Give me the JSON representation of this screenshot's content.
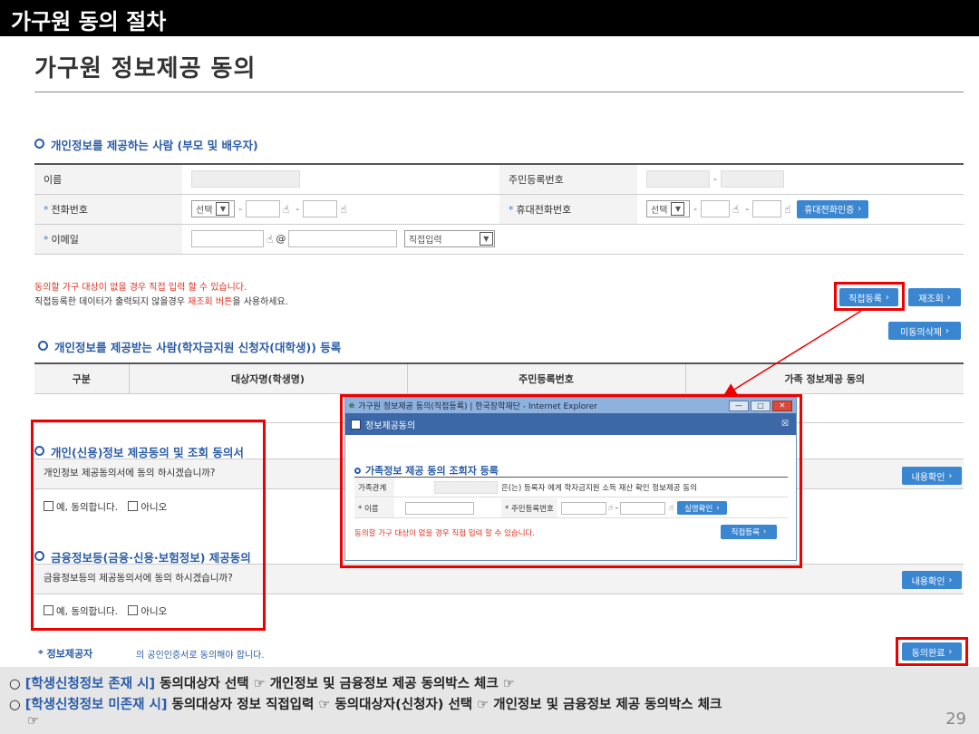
{
  "banner": "가구원 동의 절차",
  "page_title": "가구원 정보제공 동의",
  "provider_section": {
    "heading": "개인정보를 제공하는 사람 (부모 및 배우자)",
    "name_label": "이름",
    "rrn_label": "주민등록번호",
    "phone_label": "전화번호",
    "phone_select": "선택",
    "mobile_label": "휴대전화번호",
    "mobile_select": "선택",
    "mobile_verify_btn": "휴대전화인증",
    "email_label": "이메일",
    "email_at": "@",
    "email_domain_select": "직접입력"
  },
  "notes": {
    "line1": "동의할 가구 대상이 없을 경우 직접 입력 할 수 있습니다.",
    "line2_prefix": "직접등록한 데이터가 출력되지 않을경우 ",
    "line2_highlight": "재조회 버튼",
    "line2_suffix": "을 사용하세요."
  },
  "buttons": {
    "direct_register": "직접등록",
    "re_query": "재조회",
    "delete_unagreed": "미동의삭제",
    "view_content_1": "내용확인",
    "view_content_2": "내용확인",
    "agree_complete": "동의완료"
  },
  "recipient_section": {
    "heading": "개인정보를 제공받는 사람(학자금지원 신청자(대학생)) 등록",
    "columns": [
      "구분",
      "대상자명(학생명)",
      "주민등록번호",
      "가족 정보제공 동의"
    ]
  },
  "personal_credit": {
    "heading": "개인(신용)정보 제공동의 및 조회 동의서",
    "question": "개인정보 제공동의서에 동의 하시겠습니까?",
    "yes": "예, 동의합니다.",
    "no": "아니오"
  },
  "financial": {
    "heading": "금융정보등(금융·신용·보험정보) 제공동의",
    "question": "금융정보등의 제공동의서에 동의 하시겠습니까?",
    "yes": "예, 동의합니다.",
    "no": "아니오"
  },
  "info_provider": {
    "label": "* 정보제공자",
    "text": "의 공인인증서로 동의해야 합니다."
  },
  "popup": {
    "window_title": "가구원 정보제공 동의(직접등록) | 한국장학재단 - Internet Explorer",
    "win_min": "—",
    "win_max": "□",
    "win_close": "✕",
    "inner_title": "정보제공동의",
    "inner_close": "☒",
    "section_heading": "가족정보 제공 동의 조회자 등록",
    "relation_label": "가족관계",
    "relation_text": "은(는) 등록자 에게 학자금지원 소득 재산 확인 정보제공 동의",
    "name_label": "* 이름",
    "rrn_label": "* 주민등록번호",
    "verify_btn": "실명확인",
    "note": "동의할 가구 대상이 없을 경우 직접 입력 할 수 있습니다.",
    "register_btn": "직접등록"
  },
  "footer": {
    "line1_hl": "[학생신청정보 존재 시]",
    "line1_text": " 동의대상자 선택 ☞ 개인정보 및 금융정보 제공 동의박스 체크 ☞",
    "line2_hl": "[학생신청정보 미존재 시]",
    "line2_text": " 동의대상자 정보 직접입력 ☞ 동의대상자(신청자) 선택 ☞ 개인정보 및 금융정보 제공 동의박스 체크",
    "line3": "☞",
    "page_number": "29"
  },
  "colors": {
    "highlight_red": "#e00000",
    "button_blue": "#3b86d1",
    "heading_blue": "#2a5ca8"
  }
}
